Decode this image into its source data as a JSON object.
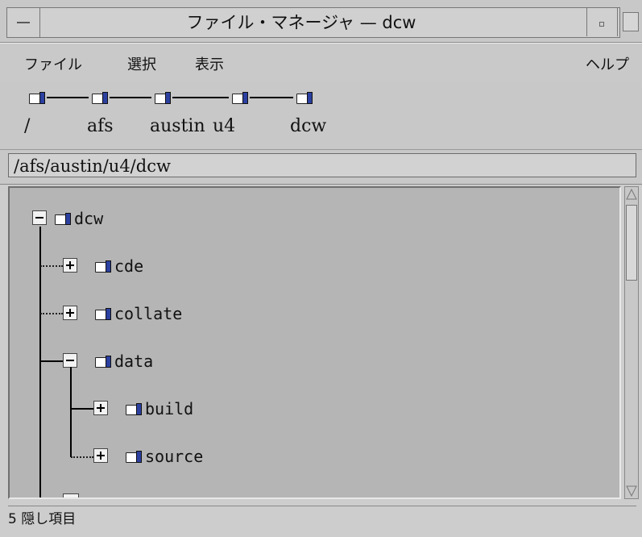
{
  "window": {
    "title": "ファイル・マネージャ — dcw"
  },
  "menubar": {
    "items": [
      {
        "label": "ファイル"
      },
      {
        "label": "選択"
      },
      {
        "label": "表示"
      }
    ],
    "help": "ヘルプ"
  },
  "icon_path": {
    "segments": [
      "/",
      "afs",
      "austin",
      "u4",
      "dcw"
    ]
  },
  "path_field": {
    "value": "/afs/austin/u4/dcw"
  },
  "tree": {
    "root": {
      "label": "dcw",
      "expanded": true
    },
    "children": [
      {
        "label": "cde",
        "expanded": false
      },
      {
        "label": "collate",
        "expanded": false
      },
      {
        "label": "data",
        "expanded": true,
        "children": [
          {
            "label": "build",
            "expanded": false
          },
          {
            "label": "source",
            "expanded": false
          }
        ]
      }
    ]
  },
  "status": {
    "text": "5 隠し項目"
  },
  "colors": {
    "folder_flap": "#2b40a0",
    "tree_bg": "#b5b5b5",
    "window_bg": "#c8c8c8"
  }
}
